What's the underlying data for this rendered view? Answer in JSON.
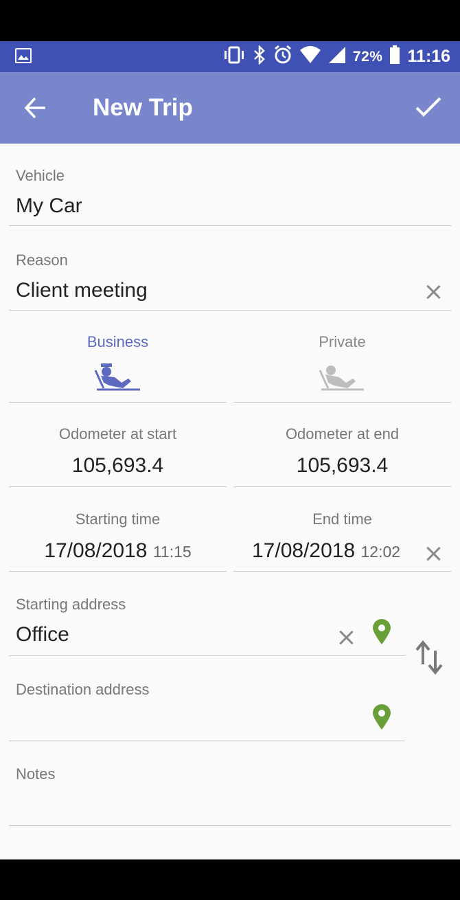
{
  "status_bar": {
    "battery": "72%",
    "time": "11:16",
    "color": "#3f51b5"
  },
  "app_bar": {
    "title": "New Trip",
    "color": "#7986cb"
  },
  "form": {
    "vehicle": {
      "label": "Vehicle",
      "value": "My Car"
    },
    "reason": {
      "label": "Reason",
      "value": "Client meeting"
    },
    "trip_type": {
      "business_label": "Business",
      "private_label": "Private",
      "selected": "Business",
      "active_color": "#5c6bc0",
      "inactive_color": "#bdbdbd"
    },
    "odometer_start": {
      "label": "Odometer at start",
      "value": "105,693.4"
    },
    "odometer_end": {
      "label": "Odometer at end",
      "value": "105,693.4"
    },
    "start_time": {
      "label": "Starting time",
      "date": "17/08/2018",
      "time": "11:15"
    },
    "end_time": {
      "label": "End time",
      "date": "17/08/2018",
      "time": "12:02"
    },
    "starting_address": {
      "label": "Starting address",
      "value": "Office"
    },
    "destination_address": {
      "label": "Destination address",
      "value": ""
    },
    "notes": {
      "label": "Notes",
      "value": ""
    },
    "pin_color": "#689f38"
  }
}
